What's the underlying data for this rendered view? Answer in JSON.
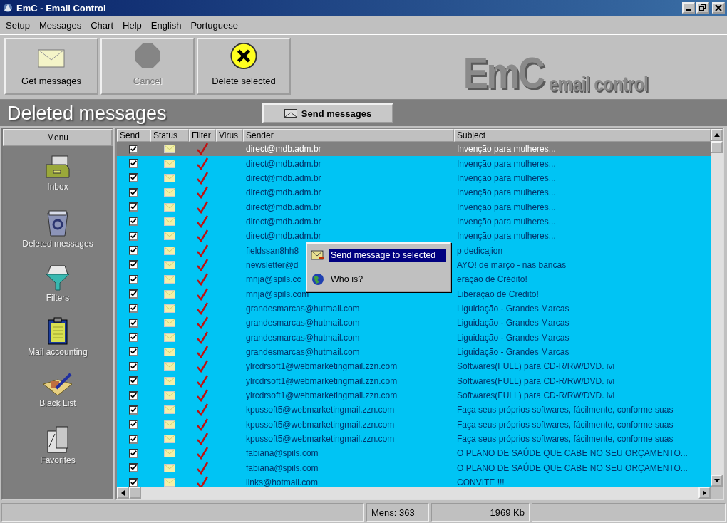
{
  "window": {
    "title": "EmC - Email Control"
  },
  "menu_bar": [
    "Setup",
    "Messages",
    "Chart",
    "Help",
    "English",
    "Portuguese"
  ],
  "toolbar": [
    {
      "label": "Get messages",
      "kind": "envelope",
      "disabled": false
    },
    {
      "label": "Cancel",
      "kind": "stop",
      "disabled": true
    },
    {
      "label": "Delete selected",
      "kind": "delete",
      "disabled": false
    }
  ],
  "logo": {
    "mark": "EmC",
    "text": "email control"
  },
  "section_title": "Deleted messages",
  "send_button": "Send messages",
  "sidebar": {
    "header": "Menu",
    "items": [
      {
        "label": "Inbox",
        "kind": "inbox"
      },
      {
        "label": "Deleted messages",
        "kind": "trash"
      },
      {
        "label": "Filters",
        "kind": "filter"
      },
      {
        "label": "Mail accounting",
        "kind": "clipboard"
      },
      {
        "label": "Black List",
        "kind": "book"
      },
      {
        "label": "Favorites",
        "kind": "folder"
      }
    ]
  },
  "table": {
    "columns": [
      "Send",
      "Status",
      "Filter",
      "Virus",
      "Sender",
      "Subject"
    ],
    "rows": [
      {
        "send": true,
        "filter": true,
        "selected": true,
        "sender": "direct@mdb.adm.br",
        "subject": "Invenção para mulheres..."
      },
      {
        "send": true,
        "filter": true,
        "selected": false,
        "sender": "direct@mdb.adm.br",
        "subject": "Invenção para mulheres..."
      },
      {
        "send": true,
        "filter": true,
        "selected": false,
        "sender": "direct@mdb.adm.br",
        "subject": "Invenção para mulheres..."
      },
      {
        "send": true,
        "filter": true,
        "selected": false,
        "sender": "direct@mdb.adm.br",
        "subject": "Invenção para mulheres..."
      },
      {
        "send": true,
        "filter": true,
        "selected": false,
        "sender": "direct@mdb.adm.br",
        "subject": "Invenção para mulheres..."
      },
      {
        "send": true,
        "filter": true,
        "selected": false,
        "sender": "direct@mdb.adm.br",
        "subject": "Invenção para mulheres..."
      },
      {
        "send": true,
        "filter": true,
        "selected": false,
        "sender": "direct@mdb.adm.br",
        "subject": "Invenção para mulheres..."
      },
      {
        "send": true,
        "filter": true,
        "selected": false,
        "sender": "fieldssan8hh8",
        "subject": "p dedicajion"
      },
      {
        "send": true,
        "filter": true,
        "selected": false,
        "sender": "newsletter@d",
        "subject": "AYO! de março - nas bancas"
      },
      {
        "send": true,
        "filter": true,
        "selected": false,
        "sender": "mnja@spils.cc",
        "subject": "eração de Crédito!"
      },
      {
        "send": true,
        "filter": true,
        "selected": false,
        "sender": "mnja@spils.com",
        "subject": "Liberação de Crédito!"
      },
      {
        "send": true,
        "filter": true,
        "selected": false,
        "sender": "grandesmarcas@hutmail.com",
        "subject": "Liguidação - Grandes Marcas"
      },
      {
        "send": true,
        "filter": true,
        "selected": false,
        "sender": "grandesmarcas@hutmail.com",
        "subject": "Liguidação - Grandes Marcas"
      },
      {
        "send": true,
        "filter": true,
        "selected": false,
        "sender": "grandesmarcas@hutmail.com",
        "subject": "Liguidação - Grandes Marcas"
      },
      {
        "send": true,
        "filter": true,
        "selected": false,
        "sender": "grandesmarcas@hutmail.com",
        "subject": "Liguidação - Grandes Marcas"
      },
      {
        "send": true,
        "filter": true,
        "selected": false,
        "sender": "ylrcdrsoft1@webmarketingmail.zzn.com",
        "subject": "Softwares(FULL) para CD-R/RW/DVD. ivi"
      },
      {
        "send": true,
        "filter": true,
        "selected": false,
        "sender": "ylrcdrsoft1@webmarketingmail.zzn.com",
        "subject": "Softwares(FULL) para CD-R/RW/DVD. ivi"
      },
      {
        "send": true,
        "filter": true,
        "selected": false,
        "sender": "ylrcdrsoft1@webmarketingmail.zzn.com",
        "subject": "Softwares(FULL) para CD-R/RW/DVD. ivi"
      },
      {
        "send": true,
        "filter": true,
        "selected": false,
        "sender": "kpussoft5@webmarketingmail.zzn.com",
        "subject": "Faça seus próprios softwares, fácilmente, conforme suas"
      },
      {
        "send": true,
        "filter": true,
        "selected": false,
        "sender": "kpussoft5@webmarketingmail.zzn.com",
        "subject": "Faça seus próprios softwares, fácilmente, conforme suas"
      },
      {
        "send": true,
        "filter": true,
        "selected": false,
        "sender": "kpussoft5@webmarketingmail.zzn.com",
        "subject": "Faça seus próprios softwares, fácilmente, conforme suas"
      },
      {
        "send": true,
        "filter": true,
        "selected": false,
        "sender": "fabiana@spils.com",
        "subject": "O PLANO DE SAÚDE QUE CABE NO SEU ORÇAMENTO..."
      },
      {
        "send": true,
        "filter": true,
        "selected": false,
        "sender": "fabiana@spils.com",
        "subject": "O PLANO DE SAÚDE QUE CABE NO SEU ORÇAMENTO..."
      },
      {
        "send": true,
        "filter": true,
        "selected": false,
        "sender": "links@hotmail.com",
        "subject": "CONVITE !!!"
      }
    ]
  },
  "context_menu": [
    {
      "label": "Send message to selected",
      "kind": "send",
      "selected": true
    },
    {
      "label": "Who is?",
      "kind": "globe",
      "selected": false
    }
  ],
  "status_bar": [
    "Mens: 363",
    "1969 Kb"
  ]
}
